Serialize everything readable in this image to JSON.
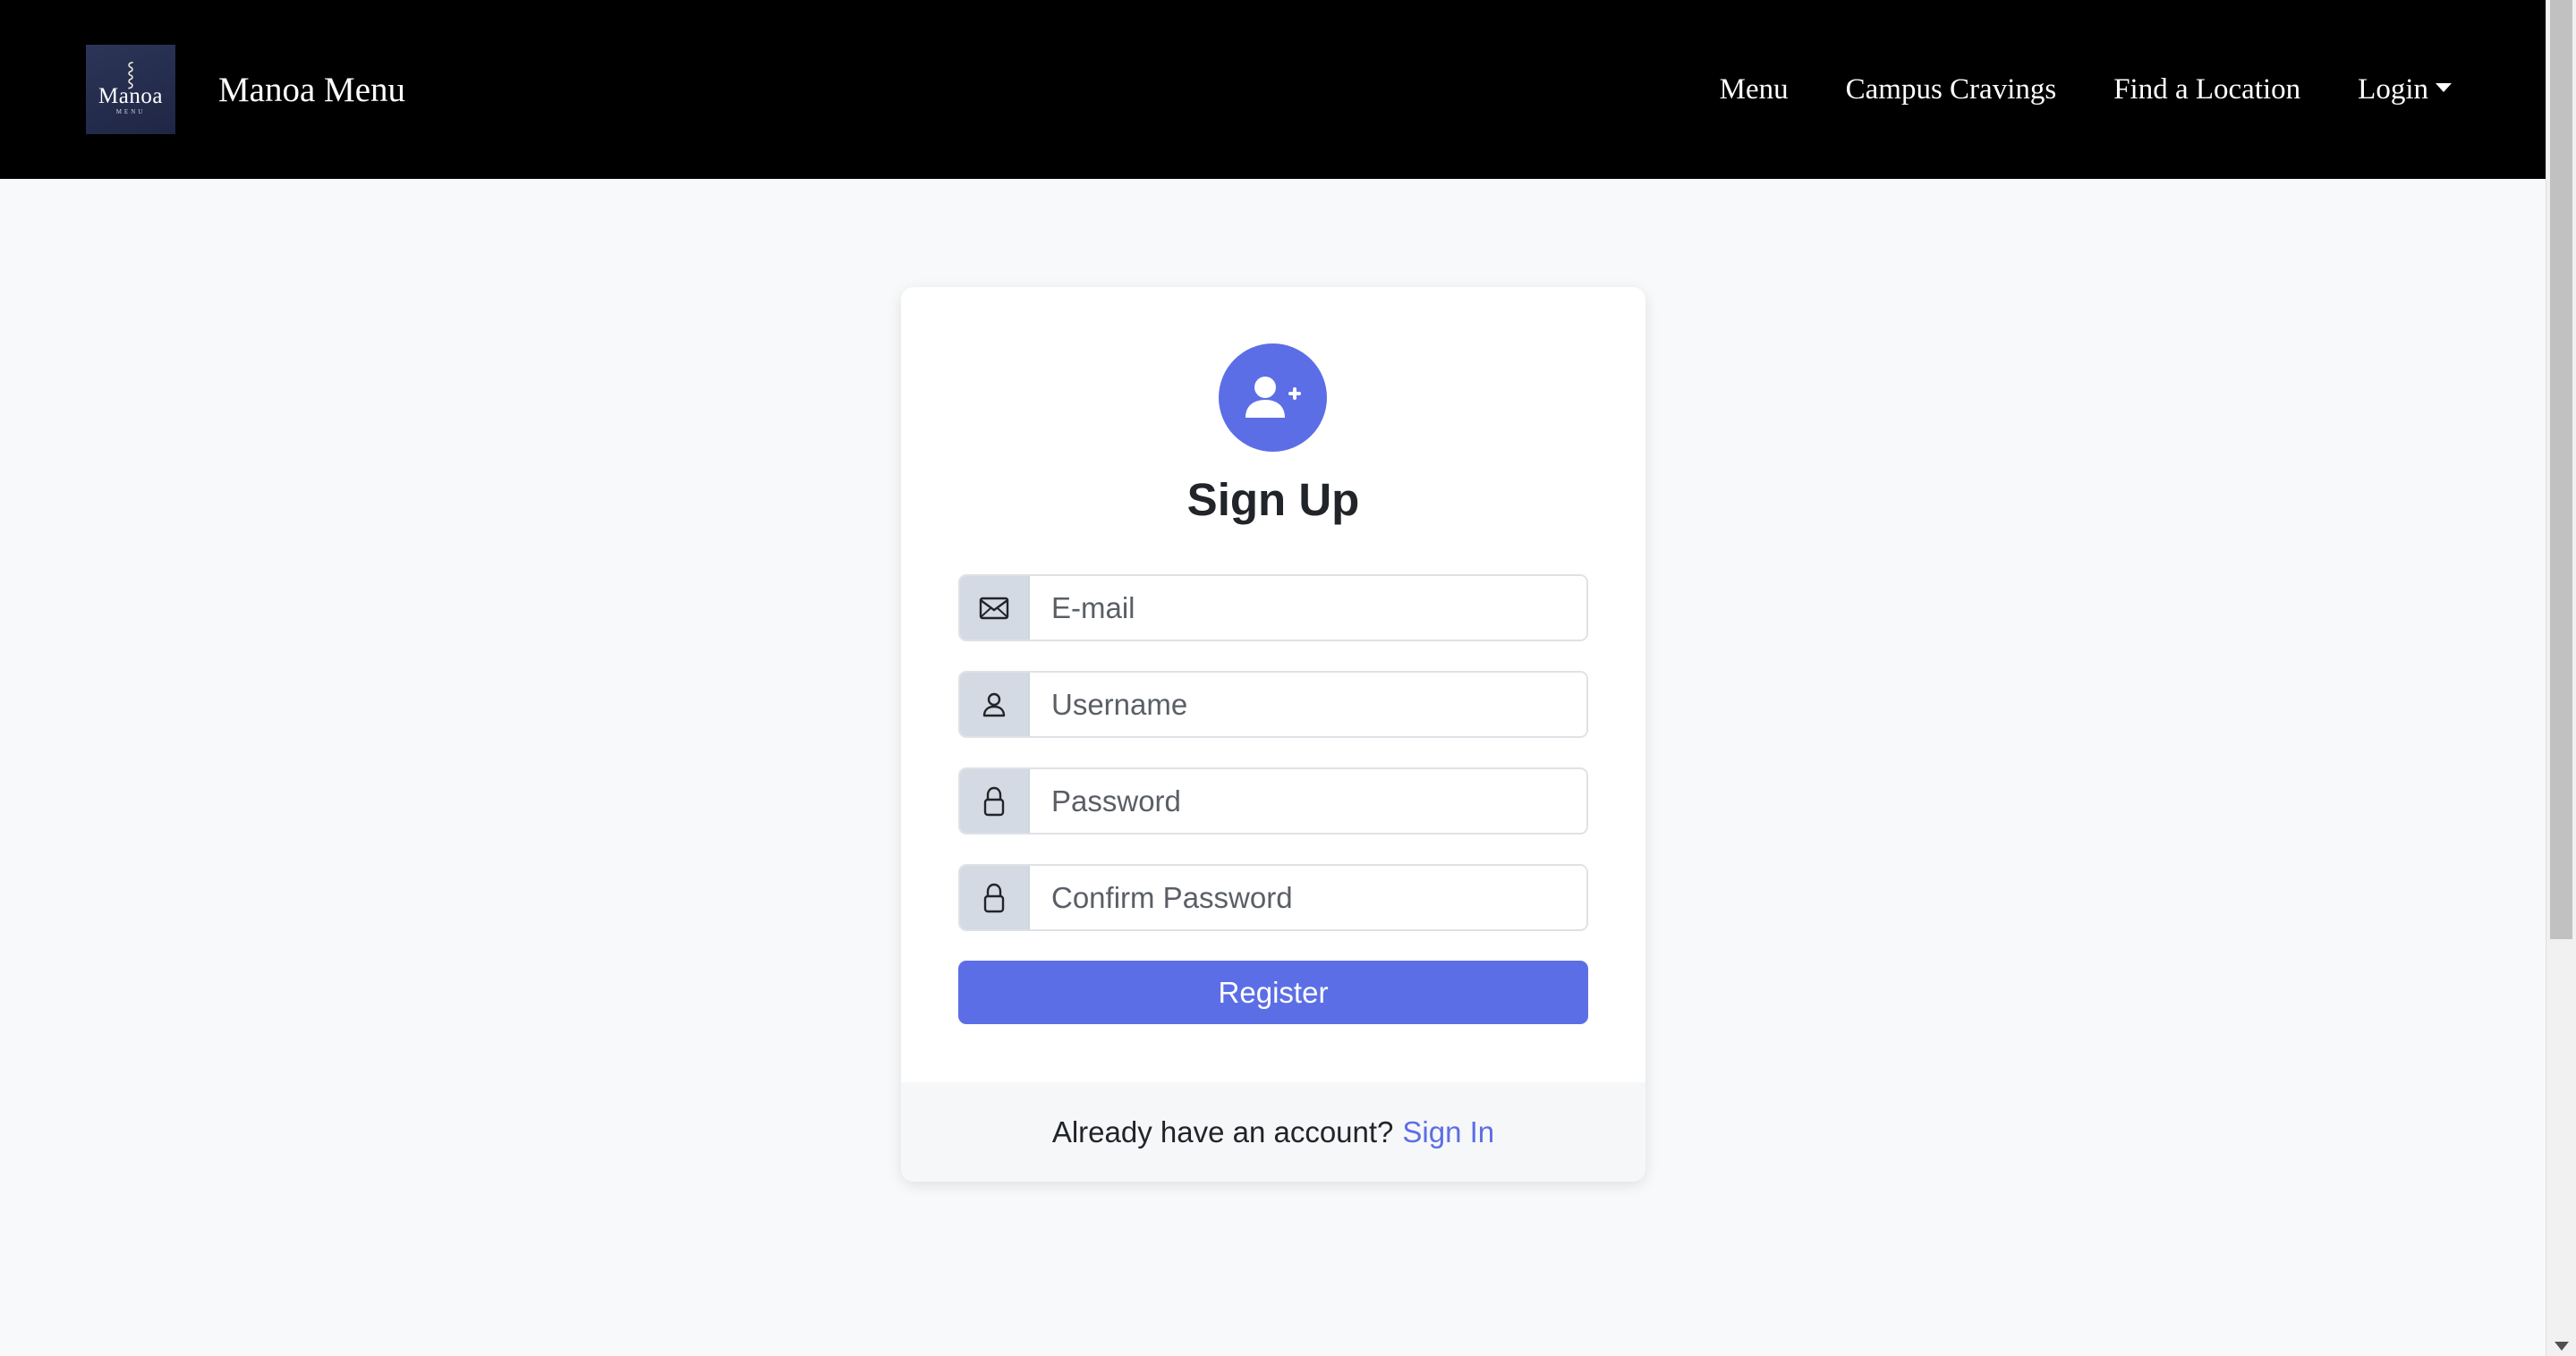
{
  "navbar": {
    "logo_text": "Manoa",
    "logo_sub": "MENU",
    "brand": "Manoa Menu",
    "links": [
      "Menu",
      "Campus Cravings",
      "Find a Location",
      "Login"
    ]
  },
  "signup": {
    "title": "Sign Up",
    "email_placeholder": "E-mail",
    "username_placeholder": "Username",
    "password_placeholder": "Password",
    "confirm_placeholder": "Confirm Password",
    "register_label": "Register",
    "footer_text": "Already have an account?",
    "signin_label": "Sign In"
  },
  "icons": {
    "avatar": "person-plus-icon",
    "email": "envelope-icon",
    "username": "person-icon",
    "password": "lock-icon",
    "confirm": "lock-icon"
  },
  "colors": {
    "navbar_bg": "#000000",
    "accent": "#5c6ee6",
    "page_bg": "#f8f9fa",
    "input_icon_bg": "#d4dae3"
  }
}
